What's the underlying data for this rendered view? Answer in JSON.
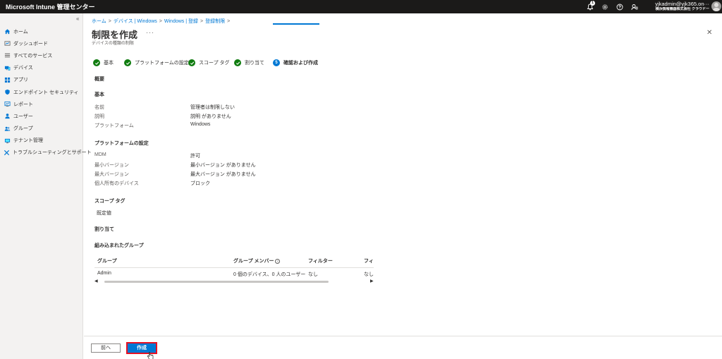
{
  "topbar": {
    "title": "Microsoft Intune 管理センター",
    "notification_count": "1",
    "user_email": "yjkadmin@yjk365.on···",
    "user_org": "横浜情報機器株式会社 クラウドー"
  },
  "sidebar": {
    "collapse": "«",
    "items": [
      {
        "label": "ホーム",
        "icon": "home-icon"
      },
      {
        "label": "ダッシュボード",
        "icon": "dashboard-icon"
      },
      {
        "label": "すべてのサービス",
        "icon": "list-icon"
      },
      {
        "label": "デバイス",
        "icon": "devices-icon"
      },
      {
        "label": "アプリ",
        "icon": "apps-icon"
      },
      {
        "label": "エンドポイント セキュリティ",
        "icon": "shield-icon"
      },
      {
        "label": "レポート",
        "icon": "report-icon"
      },
      {
        "label": "ユーザー",
        "icon": "user-icon"
      },
      {
        "label": "グループ",
        "icon": "group-icon"
      },
      {
        "label": "テナント管理",
        "icon": "tenant-icon"
      },
      {
        "label": "トラブルシューティングとサポート",
        "icon": "wrench-icon"
      }
    ]
  },
  "breadcrumb": [
    "ホーム",
    "デバイス | Windows",
    "Windows | 登録",
    "登録制限"
  ],
  "page": {
    "title": "制限を作成",
    "more": "···",
    "subtitle": "デバイスの種類の制限",
    "close": "✕"
  },
  "steps": [
    {
      "label": "基本",
      "state": "done"
    },
    {
      "label": "プラットフォームの設定",
      "state": "done"
    },
    {
      "label": "スコープ タグ",
      "state": "done"
    },
    {
      "label": "割り当て",
      "state": "done"
    },
    {
      "label": "確認および作成",
      "state": "active",
      "number": "5"
    }
  ],
  "summary": {
    "heading": "概要",
    "basics": {
      "heading": "基本",
      "rows": [
        {
          "label": "名前",
          "value": "管理者は制限しない"
        },
        {
          "label": "説明",
          "value": "説明 がありません"
        },
        {
          "label": "プラットフォーム",
          "value": "Windows"
        }
      ]
    },
    "platform": {
      "heading": "プラットフォームの設定",
      "rows": [
        {
          "label": "MDM",
          "value": "許可"
        },
        {
          "label": "最小バージョン",
          "value": "最小バージョン がありません"
        },
        {
          "label": "最大バージョン",
          "value": "最大バージョン がありません"
        },
        {
          "label": "個人所有のデバイス",
          "value": "ブロック"
        }
      ]
    },
    "scope": {
      "heading": "スコープ タグ",
      "value": "既定値"
    },
    "assignments": {
      "heading": "割り当て",
      "included_heading": "組み込まれたグループ",
      "columns": [
        "グループ",
        "グループ メンバー",
        "フィルター",
        "フィル"
      ],
      "rows": [
        [
          "Admin",
          "0 個のデバイス、0 人のユーザー",
          "なし",
          "なし"
        ]
      ]
    }
  },
  "footer": {
    "prev_label": "前へ",
    "create_label": "作成"
  },
  "colors": {
    "topbar": "#1b1a19",
    "accent": "#0078d4",
    "success": "#107c10",
    "highlight": "#e81123"
  }
}
